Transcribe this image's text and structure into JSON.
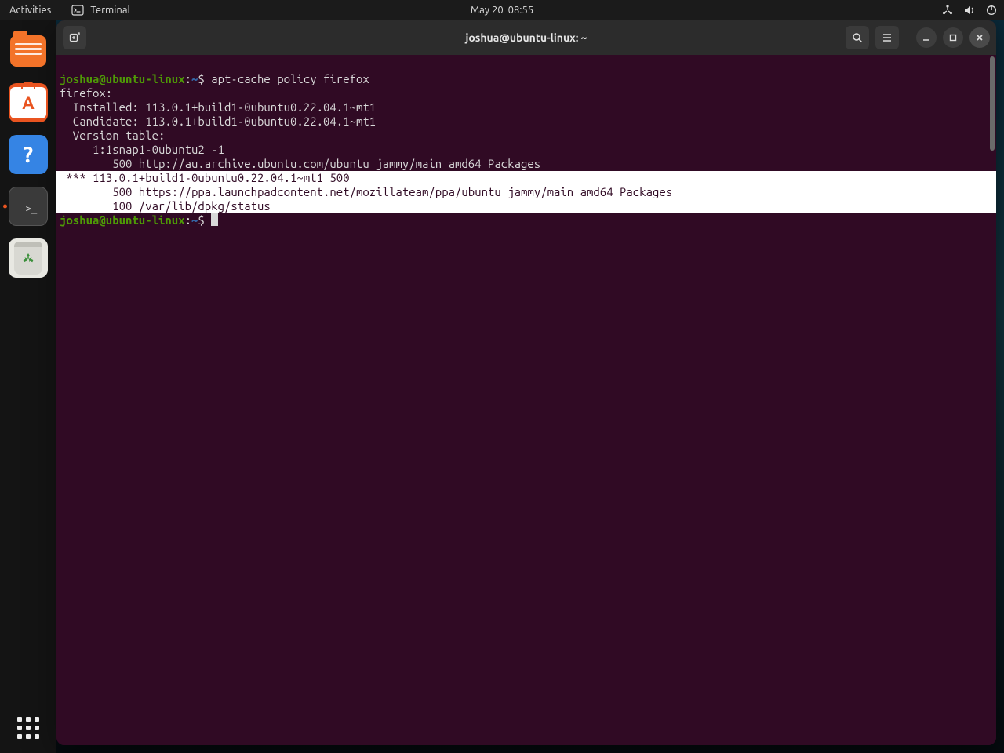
{
  "topbar": {
    "activities": "Activities",
    "app_name": "Terminal",
    "clock": "May 20  08:55"
  },
  "dock": {
    "items": [
      {
        "name": "Files"
      },
      {
        "name": "Ubuntu Software"
      },
      {
        "name": "Help"
      },
      {
        "name": "Terminal",
        "running": true
      },
      {
        "name": "Trash"
      }
    ]
  },
  "terminal": {
    "title": "joshua@ubuntu-linux: ~",
    "prompt": {
      "user_host": "joshua@ubuntu-linux",
      "colon": ":",
      "cwd": "~",
      "dollar": "$ "
    },
    "cmd1": {
      "command": "apt-cache policy firefox"
    },
    "output": {
      "l1": "firefox:",
      "l2": "  Installed: 113.0.1+build1-0ubuntu0.22.04.1~mt1",
      "l3": "  Candidate: 113.0.1+build1-0ubuntu0.22.04.1~mt1",
      "l4": "  Version table:",
      "l5": "     1:1snap1-0ubuntu2 -1",
      "l6": "        500 http://au.archive.ubuntu.com/ubuntu jammy/main amd64 Packages",
      "hl1": " *** 113.0.1+build1-0ubuntu0.22.04.1~mt1 500",
      "hl2": "        500 https://ppa.launchpadcontent.net/mozillateam/ppa/ubuntu jammy/main amd64 Packages",
      "hl3": "        100 /var/lib/dpkg/status"
    }
  }
}
